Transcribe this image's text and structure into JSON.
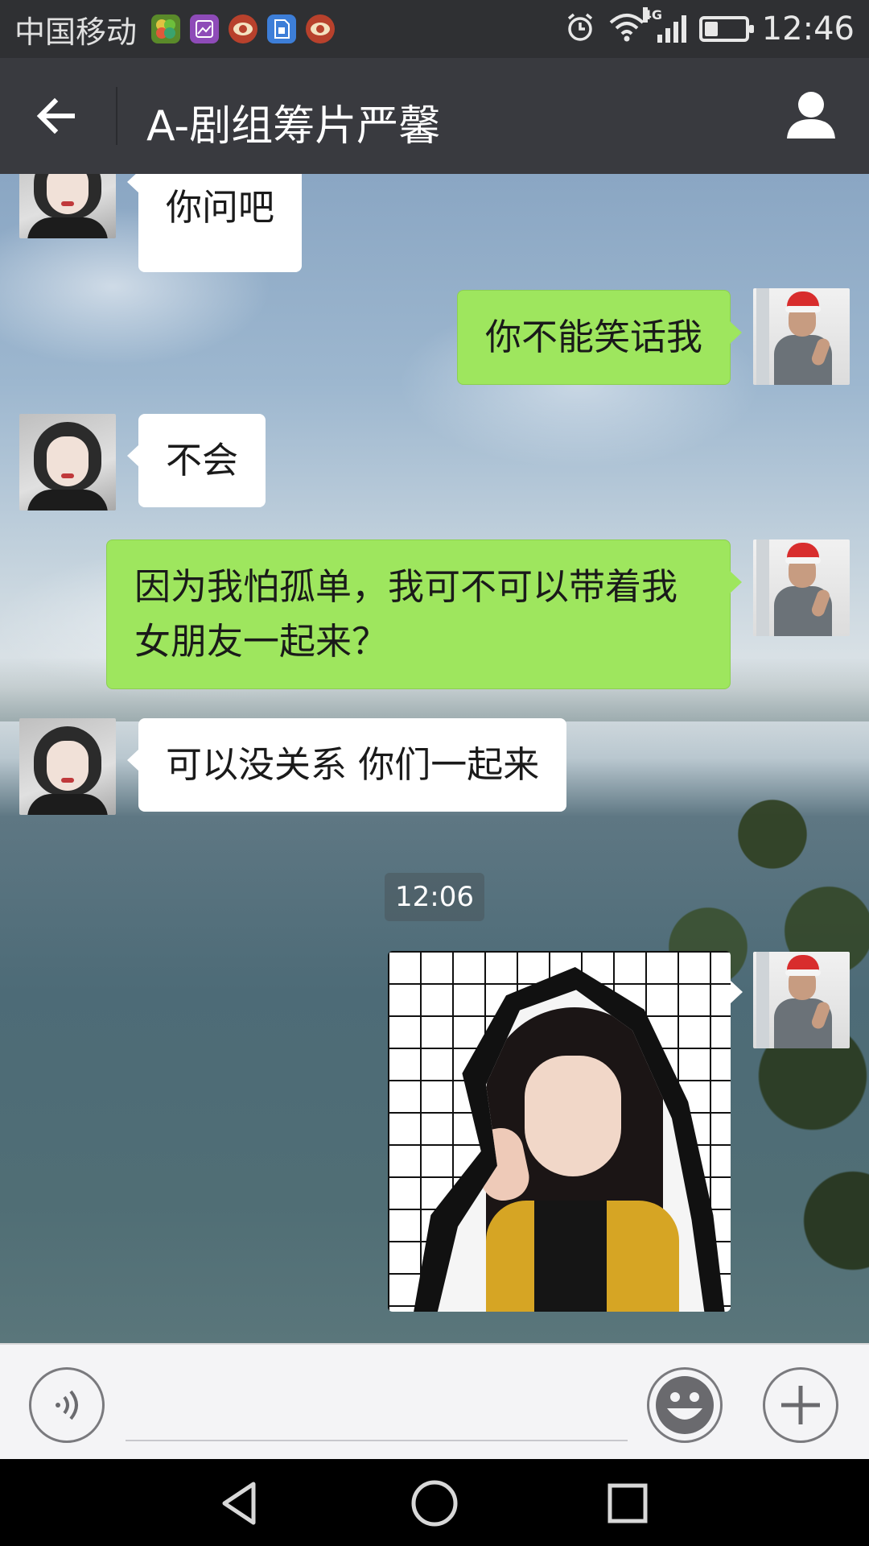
{
  "status_bar": {
    "carrier": "中国移动",
    "network": "4G",
    "time": "12:46",
    "battery_level": 0.3,
    "app_icons": [
      "clover-app-icon",
      "gallery-app-icon",
      "eye-app-icon",
      "sim-app-icon",
      "eye-app-icon"
    ]
  },
  "header": {
    "title": "A-剧组筹片严馨",
    "back_icon": "arrow-left-icon",
    "profile_icon": "person-icon"
  },
  "messages": [
    {
      "side": "in",
      "text": "你问吧"
    },
    {
      "side": "out",
      "text": "你不能笑话我"
    },
    {
      "side": "in",
      "text": "不会"
    },
    {
      "side": "out",
      "text": "因为我怕孤单，我可不可以带着我女朋友一起来？"
    },
    {
      "side": "in",
      "text": "可以没关系  你们一起来"
    },
    {
      "side": "out",
      "type": "image"
    }
  ],
  "timestamp": "12:06",
  "input_bar": {
    "voice_icon": "voice-icon",
    "emoji_icon": "emoji-icon",
    "plus_icon": "plus-icon"
  },
  "nav_bar": {
    "back_icon": "triangle-back-icon",
    "home_icon": "circle-home-icon",
    "recents_icon": "square-recents-icon"
  },
  "colors": {
    "header_bg": "#393a3f",
    "out_bubble": "#9ee65e",
    "in_bubble": "#ffffff"
  }
}
